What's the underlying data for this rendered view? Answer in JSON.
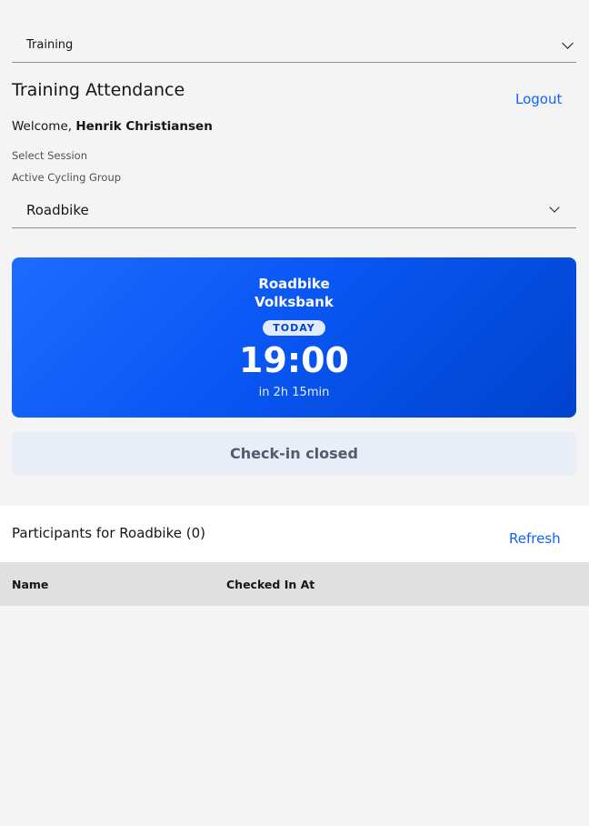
{
  "top_select": {
    "value": "Training"
  },
  "header": {
    "title": "Training Attendance",
    "logout_label": "Logout"
  },
  "welcome": {
    "prefix": "Welcome,",
    "user_name": "Henrik Christiansen"
  },
  "labels": {
    "select_session": "Select Session",
    "active_group": "Active Cycling Group"
  },
  "group_select": {
    "value": "Roadbike"
  },
  "session_card": {
    "name": "Roadbike",
    "location": "Volksbank",
    "badge": "TODAY",
    "time": "19:00",
    "relative": "in 2h 15min"
  },
  "checkin": {
    "label": "Check-in closed"
  },
  "participants": {
    "title": "Participants for Roadbike (0)",
    "refresh_label": "Refresh"
  },
  "table": {
    "columns": [
      "Name",
      "Checked In At"
    ],
    "rows": []
  },
  "colors": {
    "accent": "#0f62fe",
    "card_start": "#1f6bff",
    "card_end": "#0043ce"
  }
}
